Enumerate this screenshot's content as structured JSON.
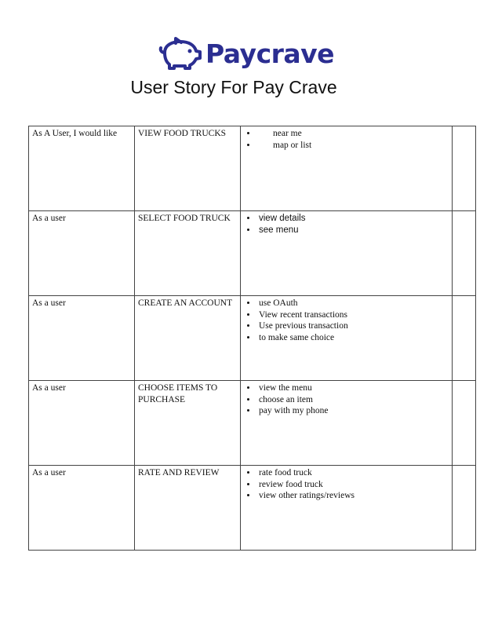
{
  "brand": {
    "name": "Paycrave",
    "icon": "piggy-bank-icon",
    "color": "#2b2e91"
  },
  "document": {
    "title": "User Story For Pay Crave"
  },
  "stories": [
    {
      "role": "As  A User, I would like",
      "action": "VIEW FOOD TRUCKS",
      "details": [
        "near me",
        "map or list"
      ],
      "extra": ""
    },
    {
      "role": "As a user",
      "action": "SELECT FOOD TRUCK",
      "details": [
        "view details",
        "see menu"
      ],
      "extra": ""
    },
    {
      "role": "As a user",
      "action": "CREATE AN ACCOUNT",
      "details": [
        "use OAuth",
        "View recent transactions",
        "Use previous transaction",
        "to make same choice"
      ],
      "extra": ""
    },
    {
      "role": "As a user",
      "action": "CHOOSE ITEMS TO PURCHASE",
      "details": [
        "view the menu",
        "choose an item",
        "pay with my phone"
      ],
      "extra": ""
    },
    {
      "role": "As a user",
      "action": "RATE AND REVIEW",
      "details": [
        "rate food truck",
        "review food truck",
        "view other ratings/reviews"
      ],
      "extra": ""
    }
  ]
}
